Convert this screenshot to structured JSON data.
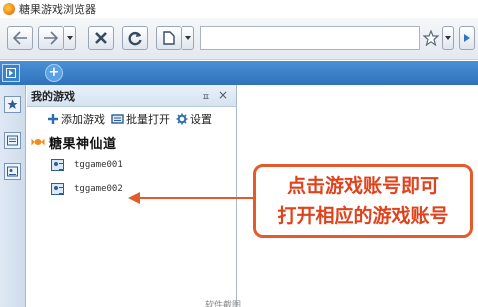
{
  "window": {
    "title": "糖果游戏浏览器"
  },
  "toolbar": {
    "back_icon": "back-arrow-icon",
    "forward_icon": "forward-arrow-icon",
    "stop_icon": "close-x-icon",
    "refresh_icon": "refresh-icon",
    "page_icon": "page-icon",
    "address_value": "",
    "favorite_icon": "star-icon"
  },
  "tabstrip": {
    "new_tab_label": "+"
  },
  "panel": {
    "title": "我的游戏",
    "pin_label": "ㅍ",
    "close_label": "×",
    "actions": [
      {
        "label": "添加游戏",
        "icon": "plus-icon"
      },
      {
        "label": "批量打开",
        "icon": "batch-open-icon"
      },
      {
        "label": "设置",
        "icon": "gear-icon"
      }
    ],
    "group": {
      "name": "糖果神仙道",
      "icon": "candy-icon"
    },
    "accounts": [
      {
        "name": "tggame001"
      },
      {
        "name": "tggame002"
      }
    ]
  },
  "callout": {
    "line1": "点击游戏账号即可",
    "line2": "打开相应的游戏账号",
    "color": "#e0421c"
  },
  "footer": {
    "text": "软件截图"
  },
  "colors": {
    "accent": "#2f72bb",
    "callout_border": "#e45a2a"
  }
}
